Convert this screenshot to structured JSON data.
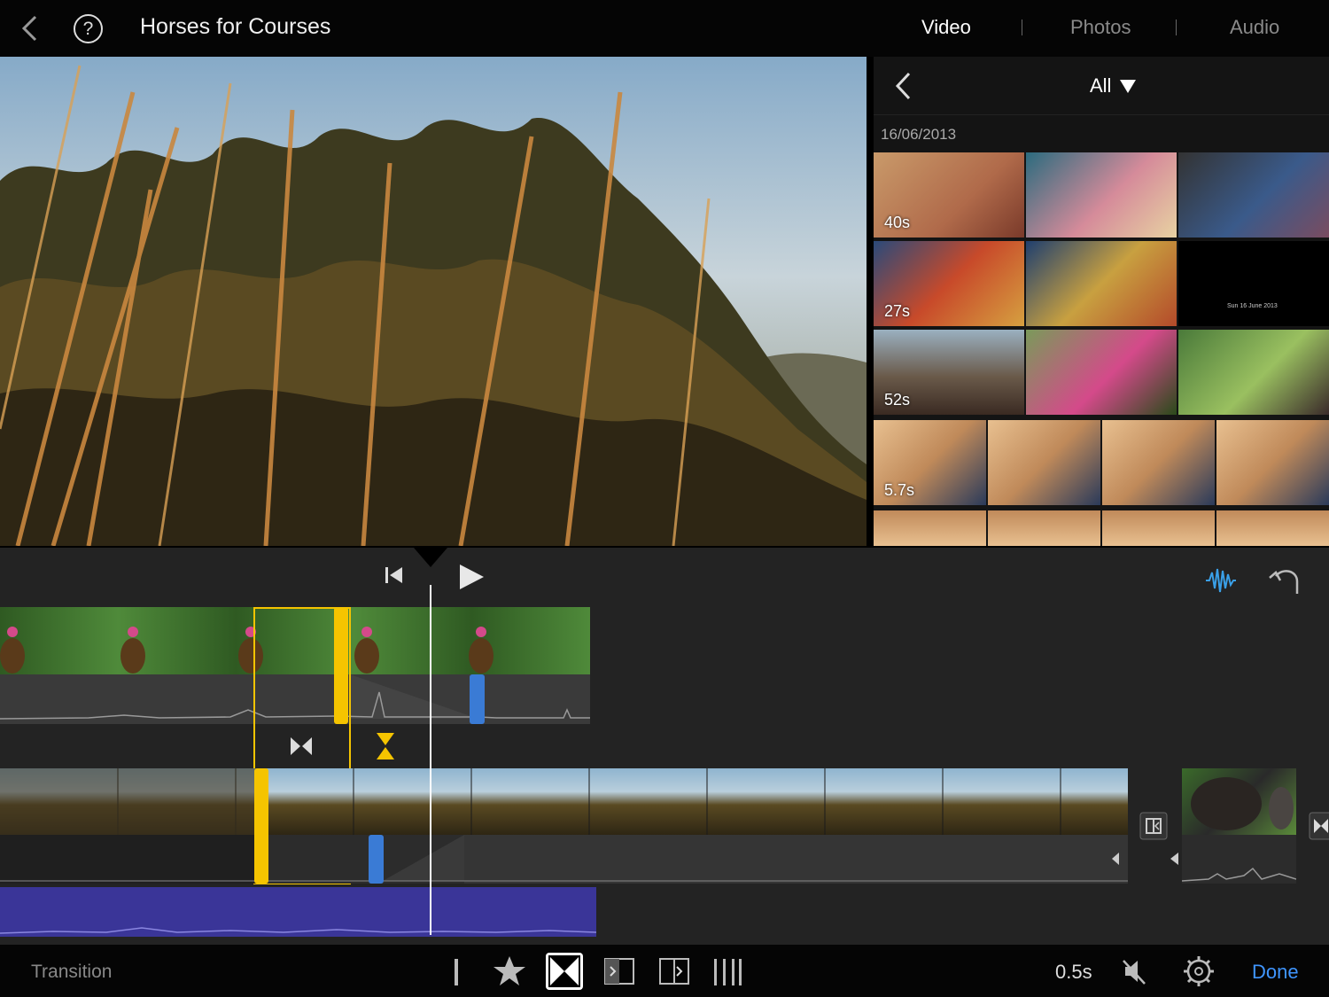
{
  "header": {
    "title": "Horses for Courses",
    "tabs": [
      {
        "label": "Video",
        "selected": true
      },
      {
        "label": "Photos",
        "selected": false
      },
      {
        "label": "Audio",
        "selected": false
      }
    ]
  },
  "browser": {
    "filter": "All",
    "date_group": "16/06/2013",
    "clips": [
      {
        "duration": "40s"
      },
      {
        "duration": "27s"
      },
      {
        "duration": "52s"
      },
      {
        "duration": "5.7s"
      }
    ],
    "title_card_text": "Sun 16 June 2013"
  },
  "toolbar": {
    "mode_label": "Transition",
    "duration": "0.5s",
    "done_label": "Done"
  },
  "colors": {
    "accent": "#3f95ff",
    "selection": "#f5c400",
    "trim_handle": "#3a7bd5",
    "music_track": "#3a3598"
  }
}
